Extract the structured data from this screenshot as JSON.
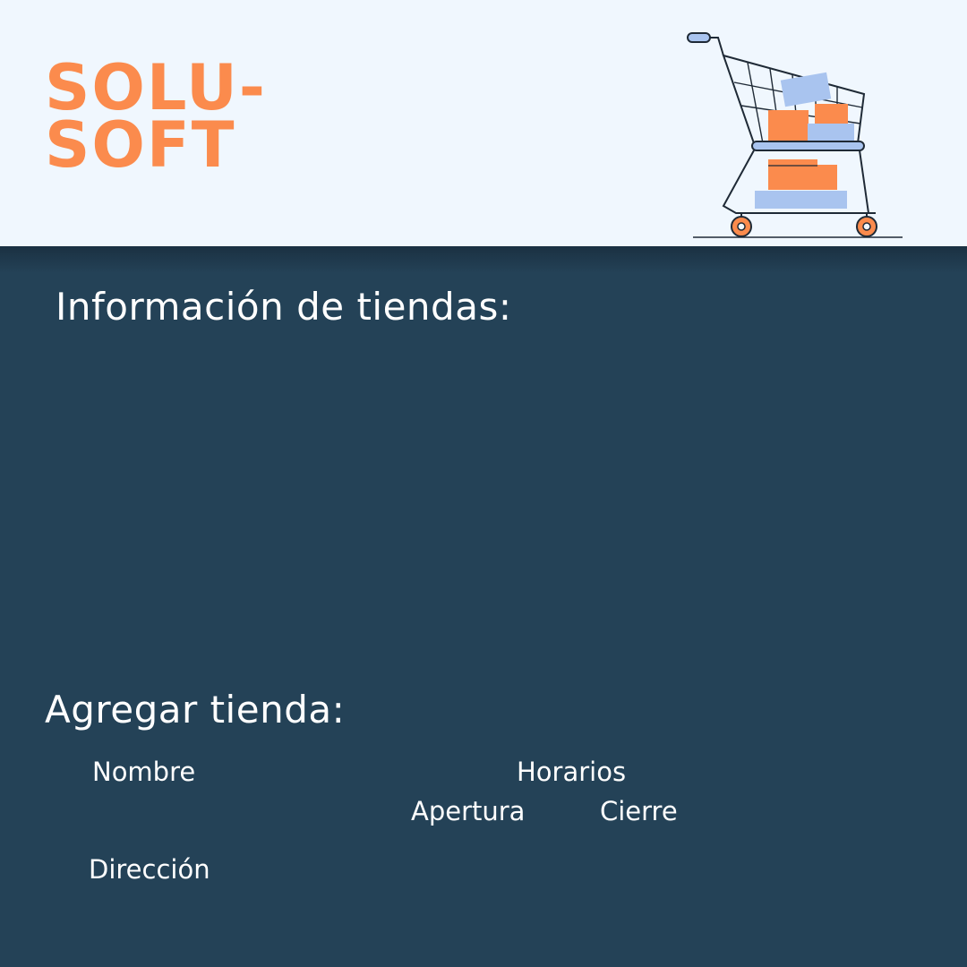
{
  "brand": {
    "line1": "SOLU-",
    "line2": "SOFT",
    "color": "#fb8b4d"
  },
  "header": {
    "background": "#f0f7fe",
    "illustration": "shopping-cart-icon"
  },
  "info_section": {
    "title": "Información de tiendas:"
  },
  "add_section": {
    "title": "Agregar tienda:",
    "labels": {
      "name": "Nombre",
      "schedule": "Horarios",
      "opening": "Apertura",
      "closing": "Cierre",
      "address": "Dirección"
    }
  },
  "colors": {
    "panel": "#244257",
    "text": "#ffffff",
    "accent_orange": "#fb8b4d",
    "accent_blue": "#a9c4ef"
  }
}
